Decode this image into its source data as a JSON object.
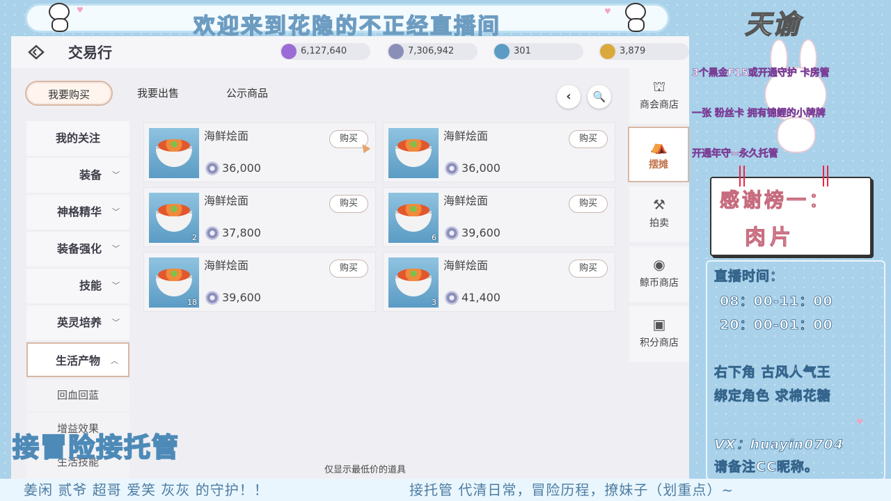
{
  "stream": {
    "banner_title": "欢迎来到花隐的不正经直播间",
    "logo": "天谕",
    "side_notes": [
      "3个黑金F15或开通守护 卡房管",
      "一张 粉丝卡 拥有锦鲤的小牌牌",
      "开通年守=永久托管"
    ],
    "thanks_title": "感谢榜一：",
    "thanks_name": "肉片",
    "schedule_label": "直播时间：",
    "schedule_1": "08：00-11：00",
    "schedule_2": "20：00-01：00",
    "promo_1": "右下角 古风人气王",
    "promo_2": "绑定角色 求棉花糖",
    "vx": "VX：huayin0704",
    "vx_note": "请备注CC昵称。",
    "overlay_text": "接冒险接托管",
    "bottom_left": "姜闲 贰爷 超哥 爱笑 灰灰 的守护！！",
    "bottom_right": "接托管 代清日常，冒险历程，撩妹子（划重点）~"
  },
  "game": {
    "title": "交易行",
    "currencies": [
      {
        "value": "6,127,640",
        "icon": "purple-crystal-icon",
        "color": "#9b6cd6"
      },
      {
        "value": "7,306,942",
        "icon": "silver-coin-icon",
        "color": "#8b8fb8"
      },
      {
        "value": "301",
        "icon": "blue-gem-icon",
        "color": "#5b9bc4"
      },
      {
        "value": "3,879",
        "icon": "gold-coin-icon",
        "color": "#d9a93c"
      }
    ],
    "subtabs": [
      "我要购买",
      "我要出售",
      "公示商品"
    ],
    "categories": [
      "我的关注",
      "装备",
      "神格精华",
      "装备强化",
      "技能",
      "英灵培养",
      "生活产物"
    ],
    "subcategories": [
      "回血回蓝",
      "增益效果",
      "生活技能"
    ],
    "items": [
      {
        "name": "海鲜烩面",
        "price": "36,000",
        "qty": "",
        "buy": "购买"
      },
      {
        "name": "海鲜烩面",
        "price": "36,000",
        "qty": "",
        "buy": "购买"
      },
      {
        "name": "海鲜烩面",
        "price": "37,800",
        "qty": "2",
        "buy": "购买"
      },
      {
        "name": "海鲜烩面",
        "price": "39,600",
        "qty": "6",
        "buy": "购买"
      },
      {
        "name": "海鲜烩面",
        "price": "39,600",
        "qty": "18",
        "buy": "购买"
      },
      {
        "name": "海鲜烩面",
        "price": "41,400",
        "qty": "3",
        "buy": "购买"
      }
    ],
    "right_tabs": [
      {
        "label": "商会商店",
        "icon": "shop-icon"
      },
      {
        "label": "摆摊",
        "icon": "stall-icon"
      },
      {
        "label": "拍卖",
        "icon": "gavel-icon"
      },
      {
        "label": "鲸币商店",
        "icon": "whale-coin-icon"
      },
      {
        "label": "积分商店",
        "icon": "points-shop-icon"
      }
    ],
    "footer_note": "仅显示最低价的道具",
    "back_label": "‹",
    "search_label": "🔍"
  }
}
